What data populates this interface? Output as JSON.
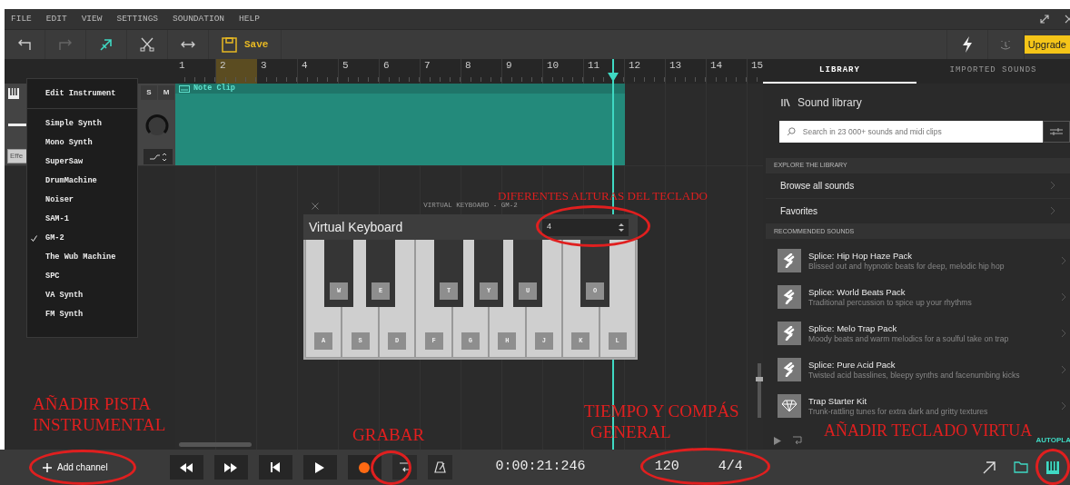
{
  "menu_bar": [
    "FILE",
    "EDIT",
    "VIEW",
    "SETTINGS",
    "SOUNDATION",
    "HELP"
  ],
  "toolbar": {
    "save": "Save",
    "upgrade": "Upgrade"
  },
  "ruler": [
    {
      "label": "1",
      "looped": false
    },
    {
      "label": "2",
      "looped": true
    },
    {
      "label": "3",
      "looped": false
    },
    {
      "label": "4",
      "looped": false
    },
    {
      "label": "5",
      "looped": false
    },
    {
      "label": "6",
      "looped": false
    },
    {
      "label": "7",
      "looped": false
    },
    {
      "label": "8",
      "looped": false
    },
    {
      "label": "9",
      "looped": false
    },
    {
      "label": "10",
      "looped": false
    },
    {
      "label": "11",
      "looped": false
    },
    {
      "label": "12",
      "looped": false
    },
    {
      "label": "13",
      "looped": false
    },
    {
      "label": "14",
      "looped": false
    },
    {
      "label": "15",
      "looped": false
    }
  ],
  "track": {
    "solo": "S",
    "mute": "M",
    "effects": "Effe",
    "clip": "Note Clip"
  },
  "instrument_menu": {
    "title": "Edit Instrument",
    "items": [
      {
        "label": "Simple Synth",
        "checked": false
      },
      {
        "label": "Mono Synth",
        "checked": false
      },
      {
        "label": "SuperSaw",
        "checked": false
      },
      {
        "label": "DrumMachine",
        "checked": false
      },
      {
        "label": "Noiser",
        "checked": false
      },
      {
        "label": "SAM-1",
        "checked": false
      },
      {
        "label": "GM-2",
        "checked": true
      },
      {
        "label": "The Wub Machine",
        "checked": false
      },
      {
        "label": "SPC",
        "checked": false
      },
      {
        "label": "VA Synth",
        "checked": false
      },
      {
        "label": "FM Synth",
        "checked": false
      }
    ]
  },
  "virtual_keyboard": {
    "window_title": "VIRTUAL KEYBOARD - GM-2",
    "title": "Virtual Keyboard",
    "octave": "4",
    "black_keys": [
      "W",
      "E",
      "T",
      "Y",
      "U",
      "O"
    ],
    "white_keys": [
      "A",
      "S",
      "D",
      "F",
      "G",
      "H",
      "J",
      "K",
      "L"
    ]
  },
  "library": {
    "tabs": [
      {
        "label": "LIBRARY",
        "selected": true
      },
      {
        "label": "IMPORTED SOUNDS",
        "selected": false
      }
    ],
    "heading": "Sound library",
    "search_placeholder": "Search in 23 000+ sounds and midi clips",
    "explore_title": "EXPLORE THE LIBRARY",
    "links": [
      "Browse all sounds",
      "Favorites"
    ],
    "recommended_title": "RECOMMENDED SOUNDS",
    "packs": [
      {
        "kind": "splice",
        "title": "Splice: Hip Hop Haze Pack",
        "description": "Blissed out and hypnotic beats for deep, melodic hip hop"
      },
      {
        "kind": "splice",
        "title": "Splice: World Beats Pack",
        "description": "Traditional percussion to spice up your rhythms"
      },
      {
        "kind": "splice",
        "title": "Splice: Melo Trap Pack",
        "description": "Moody beats and warm melodics for a soulful take on trap"
      },
      {
        "kind": "splice",
        "title": "Splice: Pure Acid Pack",
        "description": "Twisted acid basslines, bleepy synths and facenumbing kicks"
      },
      {
        "kind": "kit",
        "title": "Trap Starter Kit",
        "description": "Trunk-rattling tunes for extra dark and gritty textures"
      }
    ],
    "autoplay": "AUTOPLA"
  },
  "transport": {
    "add_channel": "Add channel",
    "time": "0:00:21:246",
    "tempo": "120",
    "signature": "4/4"
  },
  "annotations": [
    {
      "lines": [
        "DIFERENTES ALTURAS DEL TECLADO"
      ]
    },
    {
      "lines": [
        "AÑADIR PISTA",
        "INSTRUMENTAL"
      ]
    },
    {
      "lines": [
        "GRABAR"
      ]
    },
    {
      "lines": [
        "TIEMPO Y COMPÁS",
        "GENERAL"
      ]
    },
    {
      "lines": [
        "AÑADIR TECLADO VIRTUA"
      ]
    }
  ]
}
